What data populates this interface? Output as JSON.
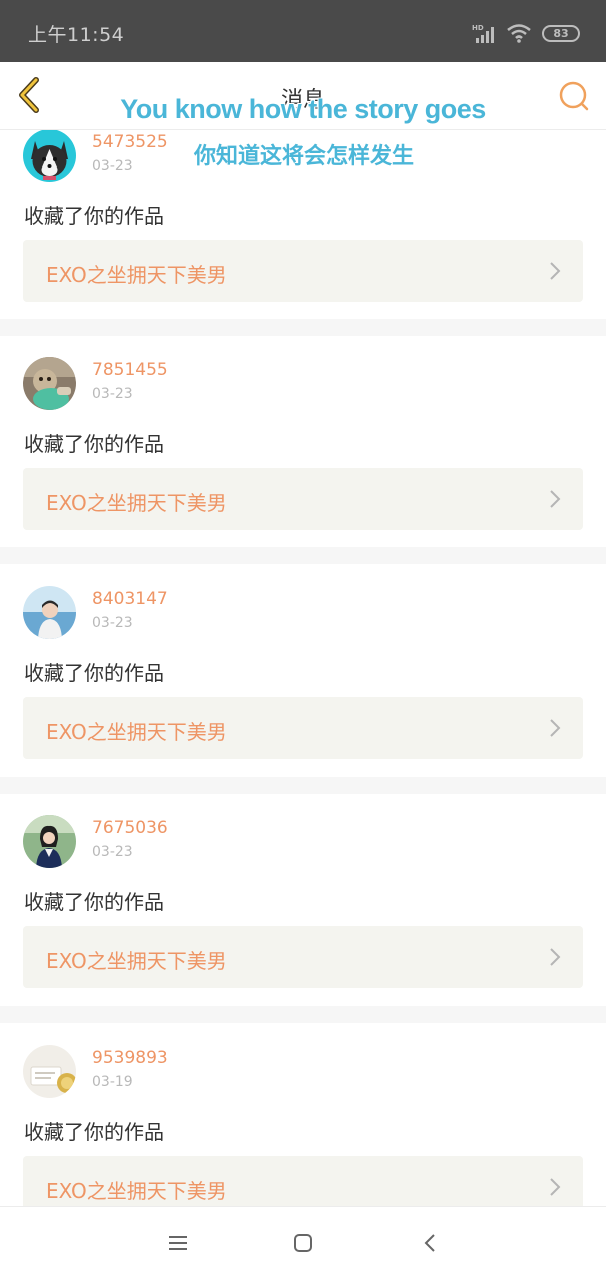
{
  "status_bar": {
    "time": "上午11:54",
    "network": "HD",
    "battery": "83"
  },
  "header": {
    "title": "消息",
    "back_icon": "chevron-left-icon",
    "search_icon": "search-icon",
    "accent_color": "#f0a15c"
  },
  "overlay": {
    "line1": "You know how the story goes",
    "line2": "你知道这将会怎样发生"
  },
  "notifications": [
    {
      "username": "5473525",
      "date": "03-23",
      "action": "收藏了你的作品",
      "work_title": "EXO之坐拥天下美男"
    },
    {
      "username": "7851455",
      "date": "03-23",
      "action": "收藏了你的作品",
      "work_title": "EXO之坐拥天下美男"
    },
    {
      "username": "8403147",
      "date": "03-23",
      "action": "收藏了你的作品",
      "work_title": "EXO之坐拥天下美男"
    },
    {
      "username": "7675036",
      "date": "03-23",
      "action": "收藏了你的作品",
      "work_title": "EXO之坐拥天下美男"
    },
    {
      "username": "9539893",
      "date": "03-19",
      "action": "收藏了你的作品",
      "work_title": "EXO之坐拥天下美男"
    }
  ],
  "colors": {
    "username": "#ee9565",
    "work_title": "#ee9565",
    "overlay_text": "#4ab6d8",
    "status_bar": "#4a4a4a"
  },
  "system_nav": {
    "icons": [
      "menu-icon",
      "home-icon",
      "back-icon"
    ]
  }
}
